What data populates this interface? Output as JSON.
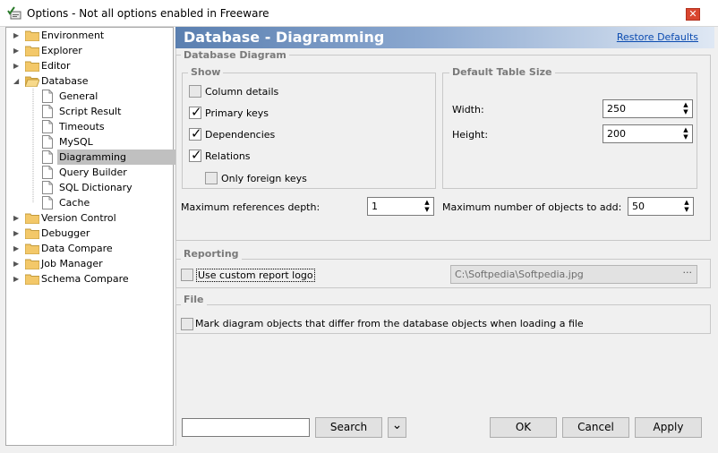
{
  "window": {
    "title": "Options - Not all options enabled in Freeware",
    "close_glyph": "✕"
  },
  "tree": {
    "items": [
      {
        "label": "Environment",
        "expanded": false
      },
      {
        "label": "Explorer",
        "expanded": false
      },
      {
        "label": "Editor",
        "expanded": false
      },
      {
        "label": "Database",
        "expanded": true
      },
      {
        "label": "Version Control",
        "expanded": false
      },
      {
        "label": "Debugger",
        "expanded": false
      },
      {
        "label": "Data Compare",
        "expanded": false
      },
      {
        "label": "Job Manager",
        "expanded": false
      },
      {
        "label": "Schema Compare",
        "expanded": false
      }
    ],
    "database_children": [
      "General",
      "Script Result",
      "Timeouts",
      "MySQL",
      "Diagramming",
      "Query Builder",
      "SQL Dictionary",
      "Cache"
    ],
    "selected": "Diagramming"
  },
  "header": {
    "title": "Database - Diagramming",
    "restore_label": "Restore Defaults"
  },
  "diagram": {
    "group_title": "Database Diagram",
    "show": {
      "title": "Show",
      "column_details": {
        "label": "Column details",
        "checked": false
      },
      "primary_keys": {
        "label": "Primary keys",
        "checked": true
      },
      "dependencies": {
        "label": "Dependencies",
        "checked": true
      },
      "relations": {
        "label": "Relations",
        "checked": true
      },
      "only_foreign_keys": {
        "label": "Only foreign keys",
        "checked": false
      }
    },
    "table_size": {
      "title": "Default Table Size",
      "width_label": "Width:",
      "width_value": "250",
      "height_label": "Height:",
      "height_value": "200"
    },
    "max_depth_label": "Maximum references depth:",
    "max_depth_value": "1",
    "max_objects_label": "Maximum number of objects to add:",
    "max_objects_value": "50"
  },
  "reporting": {
    "title": "Reporting",
    "custom_logo": {
      "label": "Use custom report logo",
      "checked": false
    },
    "logo_path": "C:\\Softpedia\\Softpedia.jpg",
    "browse_glyph": "···"
  },
  "file": {
    "title": "File",
    "mark_diff": {
      "label": "Mark diagram objects that differ from the database objects when loading a file",
      "checked": false
    }
  },
  "footer": {
    "search_value": "",
    "search_label": "Search",
    "ok_label": "OK",
    "cancel_label": "Cancel",
    "apply_label": "Apply"
  },
  "glyphs": {
    "tick": "✓",
    "arrow_collapsed": "▶",
    "arrow_expanded": "◢",
    "spin_up": "▲",
    "spin_down": "▼",
    "chevron_double": "⌄"
  }
}
